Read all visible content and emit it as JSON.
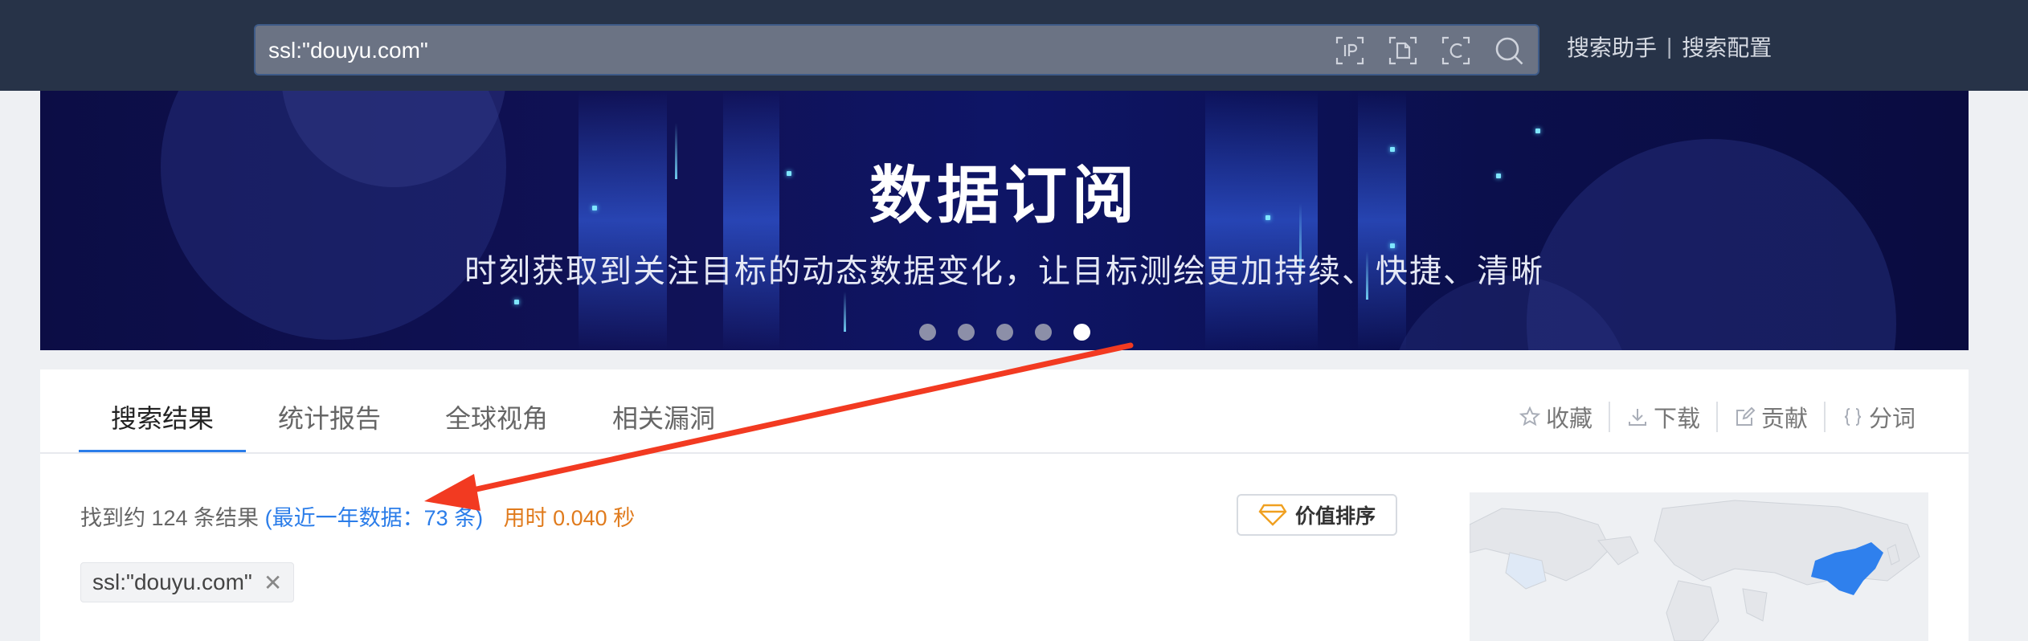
{
  "search": {
    "query": "ssl:\"douyu.com\"",
    "tools": [
      "ip-search-icon",
      "file-search-icon",
      "cert-search-icon",
      "search-icon"
    ]
  },
  "top_links": {
    "helper": "搜索助手",
    "separator": "|",
    "config": "搜索配置"
  },
  "banner": {
    "title": "数据订阅",
    "subtitle": "时刻获取到关注目标的动态数据变化，让目标测绘更加持续、快捷、清晰",
    "slides": 5,
    "active_slide": 5
  },
  "tabs": [
    {
      "label": "搜索结果",
      "active": true
    },
    {
      "label": "统计报告",
      "active": false
    },
    {
      "label": "全球视角",
      "active": false
    },
    {
      "label": "相关漏洞",
      "active": false
    }
  ],
  "actions": {
    "favorite": "收藏",
    "download": "下载",
    "contribute": "贡献",
    "tokenize": "分词"
  },
  "results": {
    "found": "找到约 124 条结果",
    "recent": "(最近一年数据：73 条)",
    "time": "用时 0.040 秒"
  },
  "sort_label": "价值排序",
  "query_tag": "ssl:\"douyu.com\"",
  "colors": {
    "topbar": "#273348",
    "accent": "#2b7de9",
    "time": "#e07b1d",
    "arrow": "#f23a21",
    "map_highlight": "#2f80ed"
  }
}
